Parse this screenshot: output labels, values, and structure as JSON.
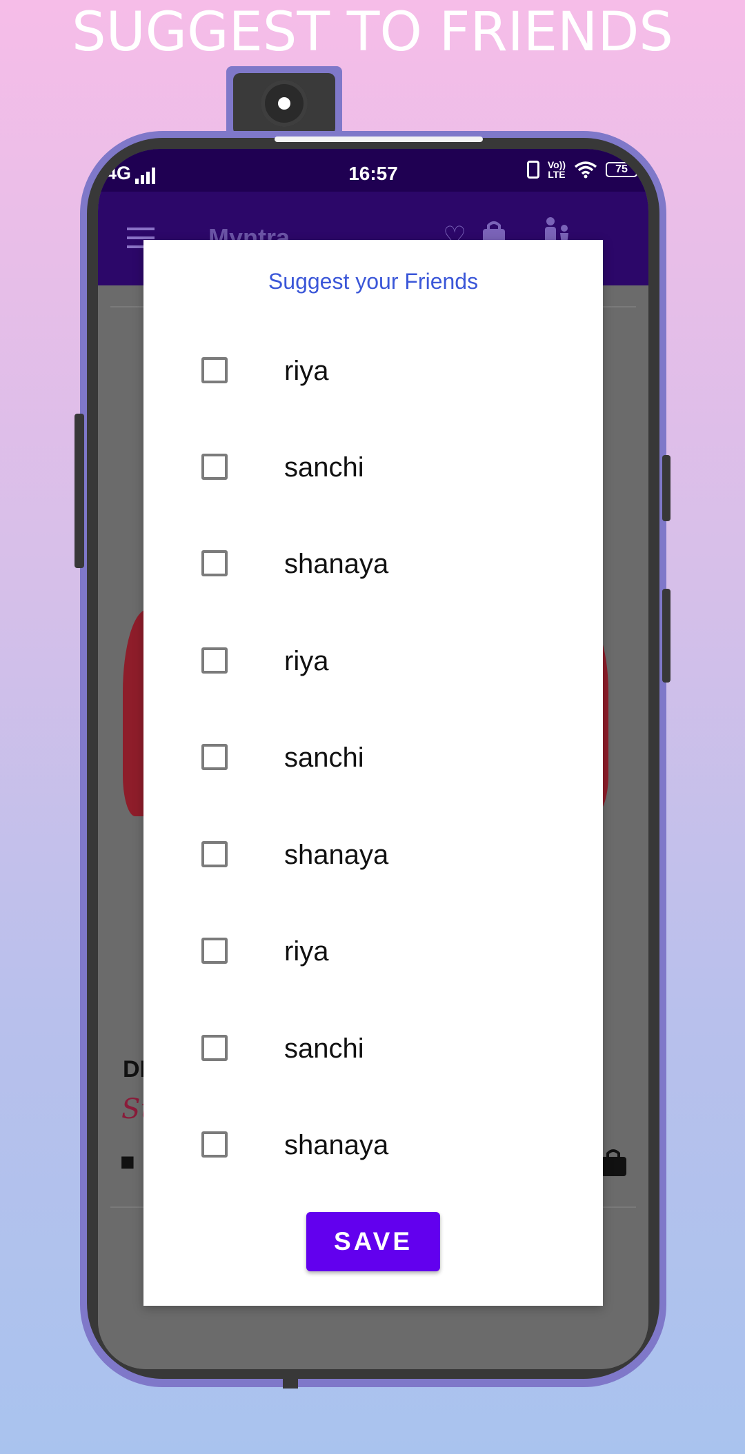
{
  "promo": {
    "headline": "SUGGEST TO FRIENDS"
  },
  "status_bar": {
    "network": "4G",
    "time": "16:57",
    "volte_top": "Vo))",
    "volte_bottom": "LTE",
    "battery": "75"
  },
  "app_bar": {
    "title": "Myntra"
  },
  "background": {
    "text_fragment": "DI",
    "script_fragment": "Su"
  },
  "dialog": {
    "title": "Suggest your Friends",
    "friends": [
      {
        "name": "riya",
        "checked": false
      },
      {
        "name": "sanchi",
        "checked": false
      },
      {
        "name": "shanaya",
        "checked": false
      },
      {
        "name": "riya",
        "checked": false
      },
      {
        "name": "sanchi",
        "checked": false
      },
      {
        "name": "shanaya",
        "checked": false
      },
      {
        "name": "riya",
        "checked": false
      },
      {
        "name": "sanchi",
        "checked": false
      },
      {
        "name": "shanaya",
        "checked": false
      }
    ],
    "save_label": "SAVE"
  },
  "colors": {
    "accent": "#6200ee",
    "title_blue": "#3b57d8",
    "status_bar": "#1f0052",
    "app_bar": "#2c0769",
    "phone_frame": "#7f78c9"
  },
  "icons": [
    "menu-icon",
    "heart-icon",
    "bag-icon",
    "family-icon",
    "signal-icon",
    "wifi-icon",
    "battery-icon",
    "vibrate-icon",
    "checkbox-icon"
  ]
}
